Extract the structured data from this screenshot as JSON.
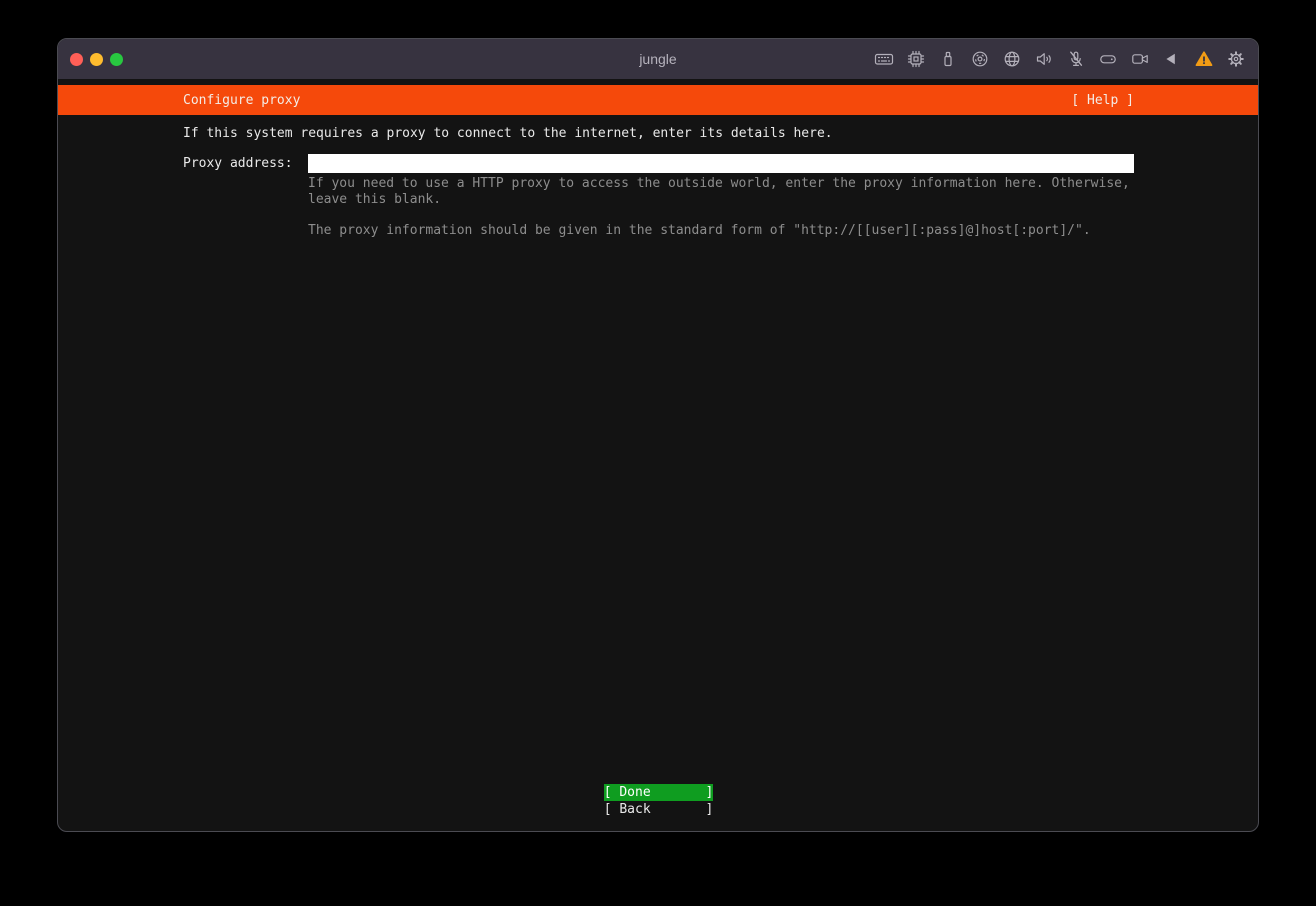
{
  "window": {
    "title": "jungle",
    "traffic_lights": [
      "close",
      "minimize",
      "zoom"
    ],
    "toolbar_icons": [
      "keyboard-icon",
      "cpu-icon",
      "usb-icon",
      "cd-icon",
      "network-icon",
      "sound-icon",
      "mic-muted-icon",
      "drive-icon",
      "camera-icon",
      "back-arrow-icon",
      "warning-icon",
      "gear-icon"
    ]
  },
  "installer": {
    "header": {
      "title": "Configure proxy",
      "help_label": "[ Help ]"
    },
    "intro": "If this system requires a proxy to connect to the internet, enter its details here.",
    "form": {
      "label": "Proxy address:",
      "value": "",
      "help": "If you need to use a HTTP proxy to access the outside world, enter the proxy information here. Otherwise,\nleave this blank.",
      "note": "The proxy information should be given in the standard form of \"http://[[user][:pass]@]host[:port]/\"."
    },
    "footer": {
      "done_label": "[ Done       ]",
      "back_label": "[ Back       ]"
    }
  },
  "colors": {
    "header_bg": "#F5490B",
    "done_button_bg": "#0F9D20",
    "titlebar_bg": "#373340",
    "terminal_bg": "#131313",
    "warning_icon": "#F29C15",
    "traffic_close": "#FF5F57",
    "traffic_minimize": "#FEBC2E",
    "traffic_zoom": "#28C840"
  }
}
